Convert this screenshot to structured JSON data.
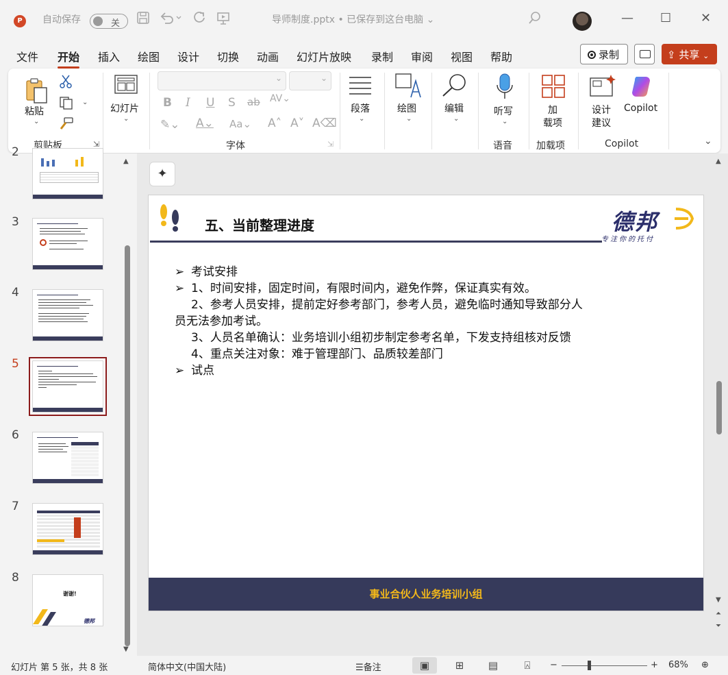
{
  "titlebar": {
    "autosave_label": "自动保存",
    "autosave_state": "关",
    "document_title": "导师制度.pptx • 已保存到这台电脑",
    "app_logo": "P"
  },
  "menu": {
    "tabs": [
      "文件",
      "开始",
      "插入",
      "绘图",
      "设计",
      "切换",
      "动画",
      "幻灯片放映",
      "录制",
      "审阅",
      "视图",
      "帮助"
    ],
    "active_tab": "开始",
    "record_label": "录制",
    "share_label": "共享"
  },
  "ribbon": {
    "paste_label": "粘贴",
    "clipboard_group": "剪贴板",
    "slides_label": "幻灯片",
    "font_group": "字体",
    "paragraph_label": "段落",
    "drawing_label": "绘图",
    "editing_label": "编辑",
    "dictate_label": "听写",
    "voice_group": "语音",
    "addins_label_1": "加",
    "addins_label_2": "载项",
    "addins_group": "加载项",
    "designer_label_1": "设计",
    "designer_label_2": "建议",
    "copilot_label": "Copilot",
    "copilot_group": "Copilot"
  },
  "thumbnails": {
    "numbers": [
      "2",
      "3",
      "4",
      "5",
      "6",
      "7",
      "8"
    ],
    "active": "5",
    "slide8_text": "谢谢!",
    "logo_small": "德邦"
  },
  "slide": {
    "title": "五、当前整理进度",
    "logo_text": "德邦",
    "logo_tagline": "专注你的托付",
    "lines": [
      {
        "bullet": "➢",
        "text": "考试安排"
      },
      {
        "bullet": "➢",
        "text": "1、时间安排，固定时间，有限时间内，避免作弊，保证真实有效。"
      },
      {
        "bullet": "",
        "text": "2、参考人员安排，提前定好参考部门，参考人员，避免临时通知导致部分人"
      },
      {
        "bullet": "",
        "text": "员无法参加考试。"
      },
      {
        "bullet": "",
        "text": "3、人员名单确认：业务培训小组初步制定参考名单，下发支持组核对反馈"
      },
      {
        "bullet": "",
        "text": "4、重点关注对象：难于管理部门、品质较差部门"
      },
      {
        "bullet": "➢",
        "text": "试点"
      }
    ],
    "footer": "事业合伙人业务培训小组"
  },
  "statusbar": {
    "slide_info": "幻灯片 第 5 张，共 8 张",
    "language": "简体中文(中国大陆)",
    "notes_label": "备注",
    "zoom": "68%"
  },
  "colors": {
    "accent": "#c43e1c",
    "slide_navy": "#363a5b",
    "footer_text": "#f3b81a",
    "logo_navy": "#2c2f6b"
  }
}
